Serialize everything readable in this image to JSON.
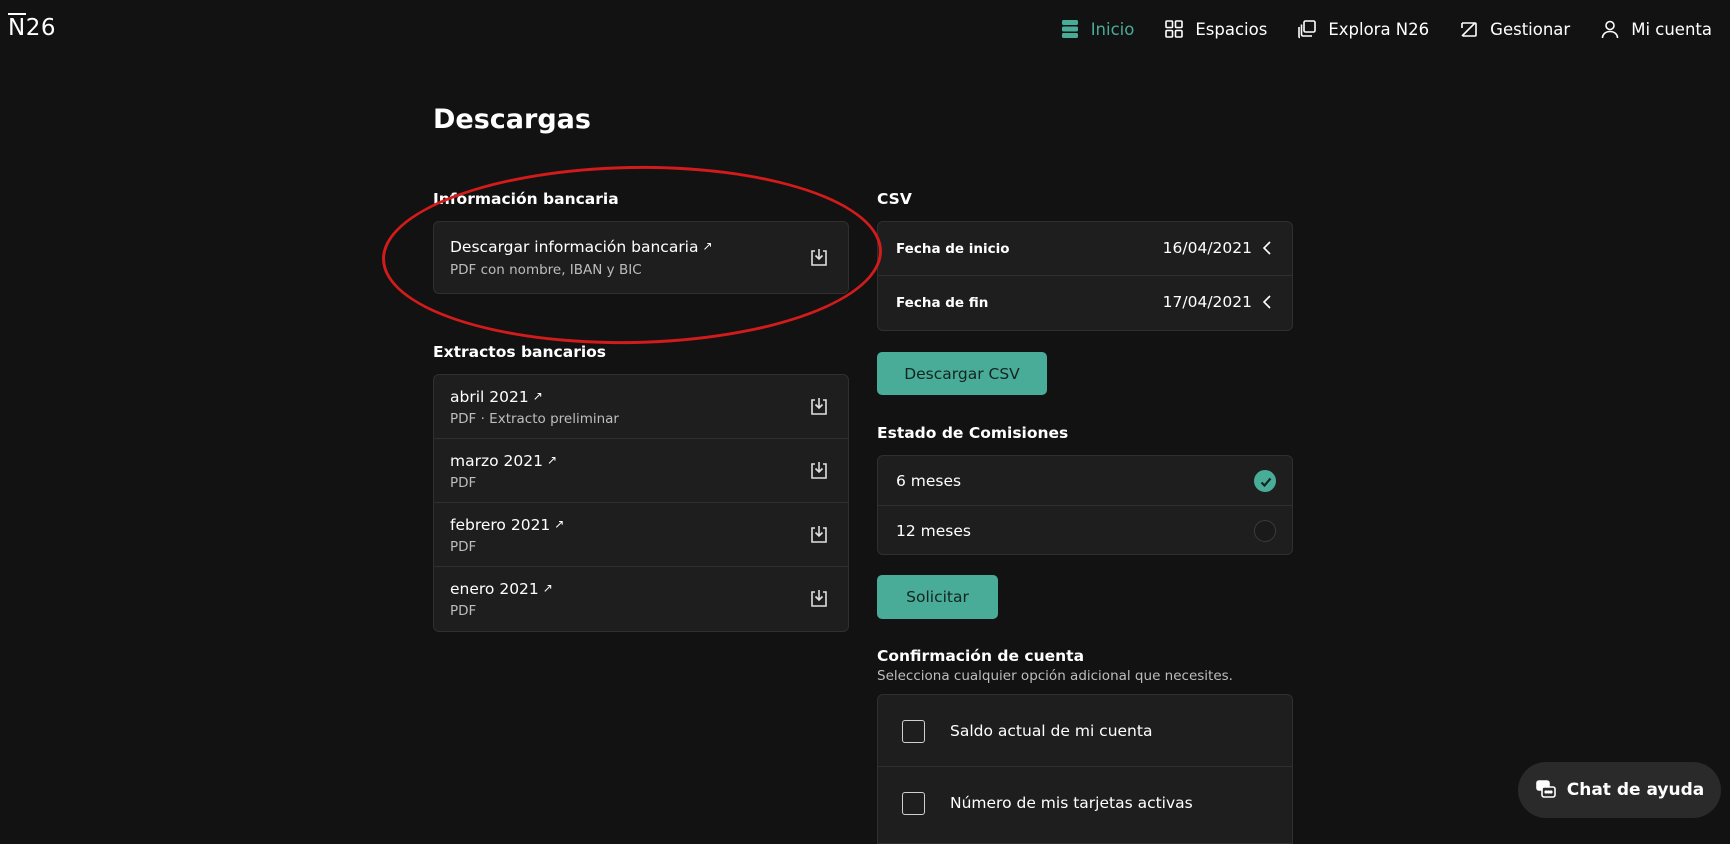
{
  "brand": {
    "logo": "N26",
    "logo_n": "N",
    "logo_rest": "26"
  },
  "nav": {
    "items": [
      {
        "label": "Inicio",
        "icon": "home-icon",
        "active": true
      },
      {
        "label": "Espacios",
        "icon": "spaces-icon",
        "active": false
      },
      {
        "label": "Explora N26",
        "icon": "explore-icon",
        "active": false
      },
      {
        "label": "Gestionar",
        "icon": "manage-icon",
        "active": false
      },
      {
        "label": "Mi cuenta",
        "icon": "user-icon",
        "active": false
      }
    ]
  },
  "page": {
    "title": "Descargas"
  },
  "bank_info": {
    "section_label": "Información bancaria",
    "item": {
      "title": "Descargar información bancaria",
      "subtitle": "PDF con nombre, IBAN y BIC"
    }
  },
  "statements": {
    "section_label": "Extractos bancarios",
    "items": [
      {
        "title": "abril 2021",
        "subtitle": "PDF · Extracto preliminar"
      },
      {
        "title": "marzo 2021",
        "subtitle": "PDF"
      },
      {
        "title": "febrero 2021",
        "subtitle": "PDF"
      },
      {
        "title": "enero 2021",
        "subtitle": "PDF"
      }
    ]
  },
  "csv": {
    "section_label": "CSV",
    "start_label": "Fecha de inicio",
    "start_value": "16/04/2021",
    "end_label": "Fecha de fin",
    "end_value": "17/04/2021",
    "button_label": "Descargar CSV"
  },
  "fees": {
    "section_label": "Estado de Comisiones",
    "options": [
      {
        "label": "6 meses",
        "selected": true
      },
      {
        "label": "12 meses",
        "selected": false
      }
    ],
    "button_label": "Solicitar"
  },
  "confirmation": {
    "section_label": "Confirmación de cuenta",
    "subtitle": "Selecciona cualquier opción adicional que necesites.",
    "options": [
      {
        "label": "Saldo actual de mi cuenta",
        "checked": false
      },
      {
        "label": "Número de mis tarjetas activas",
        "checked": false
      }
    ]
  },
  "chat": {
    "label": "Chat de ayuda",
    "icon": "chat-icon"
  },
  "colors": {
    "accent": "#48ac98",
    "background": "#121212",
    "card": "#1e1e1e",
    "annotation": "#d21b1b"
  }
}
